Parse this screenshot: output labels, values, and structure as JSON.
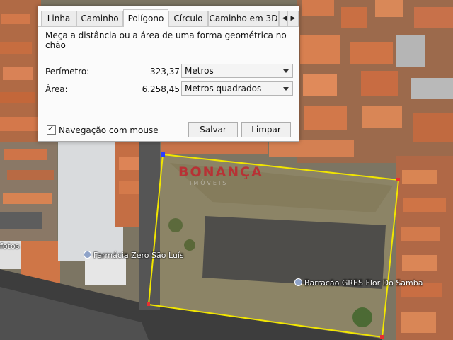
{
  "dialog": {
    "tabs": [
      {
        "label": "Linha"
      },
      {
        "label": "Caminho"
      },
      {
        "label": "Polígono"
      },
      {
        "label": "Círculo"
      },
      {
        "label": "Caminho em 3D"
      }
    ],
    "active_tab": "Polígono",
    "description": "Meça a distância ou a área de uma forma geométrica no chão",
    "perimeter": {
      "label": "Perímetro:",
      "value": "323,37",
      "unit": "Metros"
    },
    "area": {
      "label": "Área:",
      "value": "6.258,45",
      "unit": "Metros quadrados"
    },
    "mouse_nav": {
      "label": "Navegação com mouse",
      "checked": true
    },
    "save_label": "Salvar",
    "clear_label": "Limpar"
  },
  "map": {
    "labels": {
      "pharmacy": "Farmácia Zero São Luís",
      "warehouse": "Barracão GRES Flor Do Samba",
      "left_edge": "fotos"
    },
    "watermark": {
      "brand": "BONANÇA",
      "sub": "IMÓVEIS"
    },
    "polygon_color": "#f2e600",
    "icons": [
      "map-pin-icon",
      "measure-polygon"
    ]
  }
}
